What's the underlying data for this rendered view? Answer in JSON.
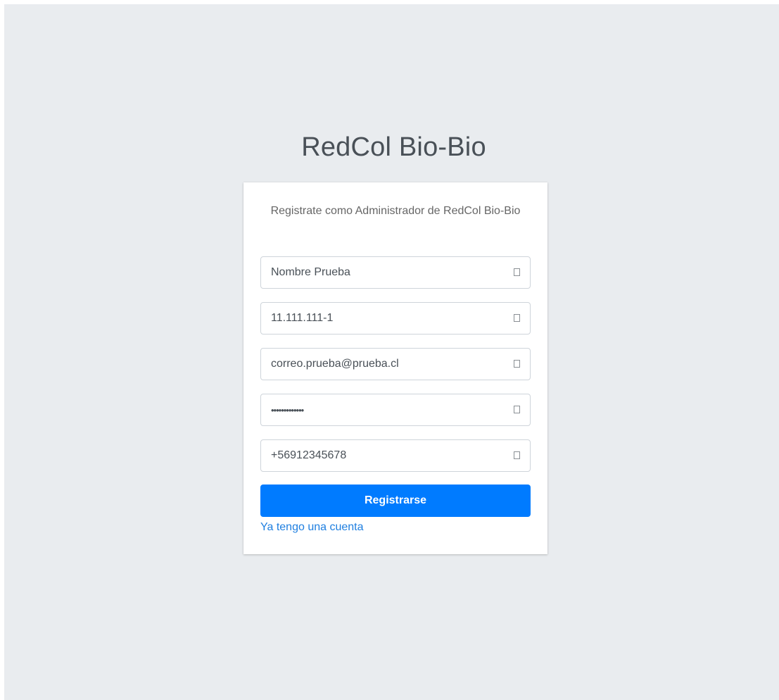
{
  "brand": {
    "title": "RedCol Bio-Bio"
  },
  "card": {
    "message": "Registrate como Administrador de RedCol Bio-Bio"
  },
  "form": {
    "fields": [
      {
        "name": "nombre",
        "type": "text",
        "value": "Nombre Prueba",
        "icon": "field-icon"
      },
      {
        "name": "rut",
        "type": "text",
        "value": "11.111.111-1",
        "icon": "field-icon"
      },
      {
        "name": "email",
        "type": "email",
        "value": "correo.prueba@prueba.cl",
        "icon": "field-icon"
      },
      {
        "name": "password",
        "type": "password",
        "value": "•••••••••••••",
        "icon": "field-icon"
      },
      {
        "name": "telefono",
        "type": "tel",
        "value": "+56912345678",
        "icon": "field-icon"
      }
    ],
    "submit_label": "Registrarse",
    "login_link_label": "Ya tengo una cuenta"
  },
  "colors": {
    "page_background": "#e9ecef",
    "primary": "#007bff",
    "link": "#1f7fe0"
  }
}
